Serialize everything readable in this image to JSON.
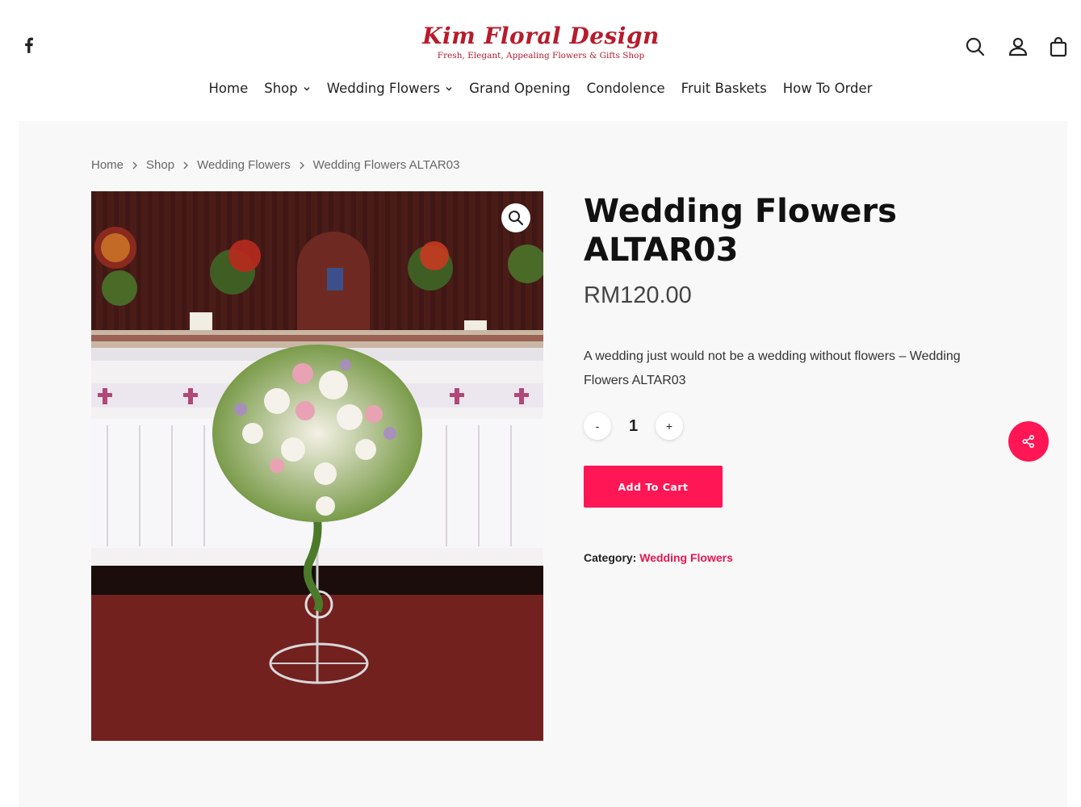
{
  "brand": {
    "title": "Kim Floral Design",
    "tagline": "Fresh, Elegant, Appealing Flowers & Gifts Shop",
    "color": "#b71c2c"
  },
  "header_icons": {
    "social": "facebook-icon",
    "search": "search-icon",
    "account": "user-icon",
    "cart": "shopping-bag-icon"
  },
  "nav": [
    {
      "label": "Home"
    },
    {
      "label": "Shop"
    },
    {
      "label": "Wedding Flowers"
    },
    {
      "label": "Grand Opening"
    },
    {
      "label": "Condolence"
    },
    {
      "label": "Fruit Baskets"
    },
    {
      "label": "How To Order"
    }
  ],
  "breadcrumb": [
    "Home",
    "Shop",
    "Wedding Flowers",
    "Wedding Flowers ALTAR03"
  ],
  "product": {
    "title": "Wedding Flowers ALTAR03",
    "price": "RM120.00",
    "description": "A wedding just would not be a wedding without flowers – Wedding Flowers ALTAR03",
    "quantity": "1",
    "qty_minus": "-",
    "qty_plus": "+",
    "add_to_cart": "Add To Cart",
    "category_label": "Category:",
    "category_value": "Wedding Flowers"
  },
  "colors": {
    "accent": "#ff1655",
    "link": "#e8164f",
    "content_bg": "#f8f8f8"
  }
}
